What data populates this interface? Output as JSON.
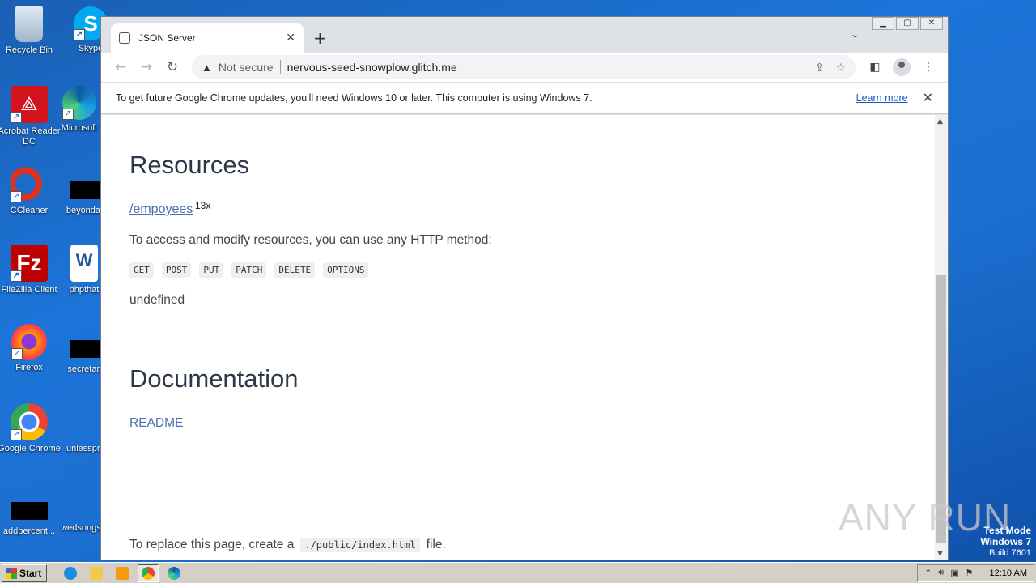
{
  "desktop": {
    "icons": [
      {
        "label": "Recycle Bin"
      },
      {
        "label": "Skype"
      },
      {
        "label": "Acrobat Reader DC"
      },
      {
        "label": "Microsoft"
      },
      {
        "label": "CCleaner"
      },
      {
        "label": "beyondag"
      },
      {
        "label": "FileZilla Client"
      },
      {
        "label": "phpthat"
      },
      {
        "label": "Firefox"
      },
      {
        "label": "secretary"
      },
      {
        "label": "Google Chrome"
      },
      {
        "label": "unlesspri"
      },
      {
        "label": "addpercent..."
      },
      {
        "label": "wedsongs"
      }
    ],
    "watermark": "ANY RUN",
    "test_mode": {
      "line1": "Test Mode",
      "line2": "Windows 7",
      "line3": "Build 7601"
    }
  },
  "browser": {
    "tab_title": "JSON Server",
    "tab_close": "✕",
    "new_tab": "+",
    "tab_menu": "⌄",
    "security_label": "Not secure",
    "url": "nervous-seed-snowplow.glitch.me",
    "infobar": {
      "message": "To get future Google Chrome updates, you'll need Windows 10 or later. This computer is using Windows 7.",
      "link": "Learn more",
      "close": "✕"
    }
  },
  "page": {
    "resources_heading": "Resources",
    "resource_link": "/empoyees",
    "resource_count": "13x",
    "access_text": "To access and modify resources, you can use any HTTP method:",
    "methods": [
      "GET",
      "POST",
      "PUT",
      "PATCH",
      "DELETE",
      "OPTIONS"
    ],
    "undefined_text": "undefined",
    "documentation_heading": "Documentation",
    "readme_link": "README",
    "footer_prefix": "To replace this page, create a",
    "footer_code": "./public/index.html",
    "footer_suffix": "file."
  },
  "taskbar": {
    "start_label": "Start",
    "clock": "12:10 AM"
  },
  "colors": {
    "desktop_blue": "#1c74d8",
    "link_blue": "#4a6fb0",
    "heading": "#2d3748"
  }
}
